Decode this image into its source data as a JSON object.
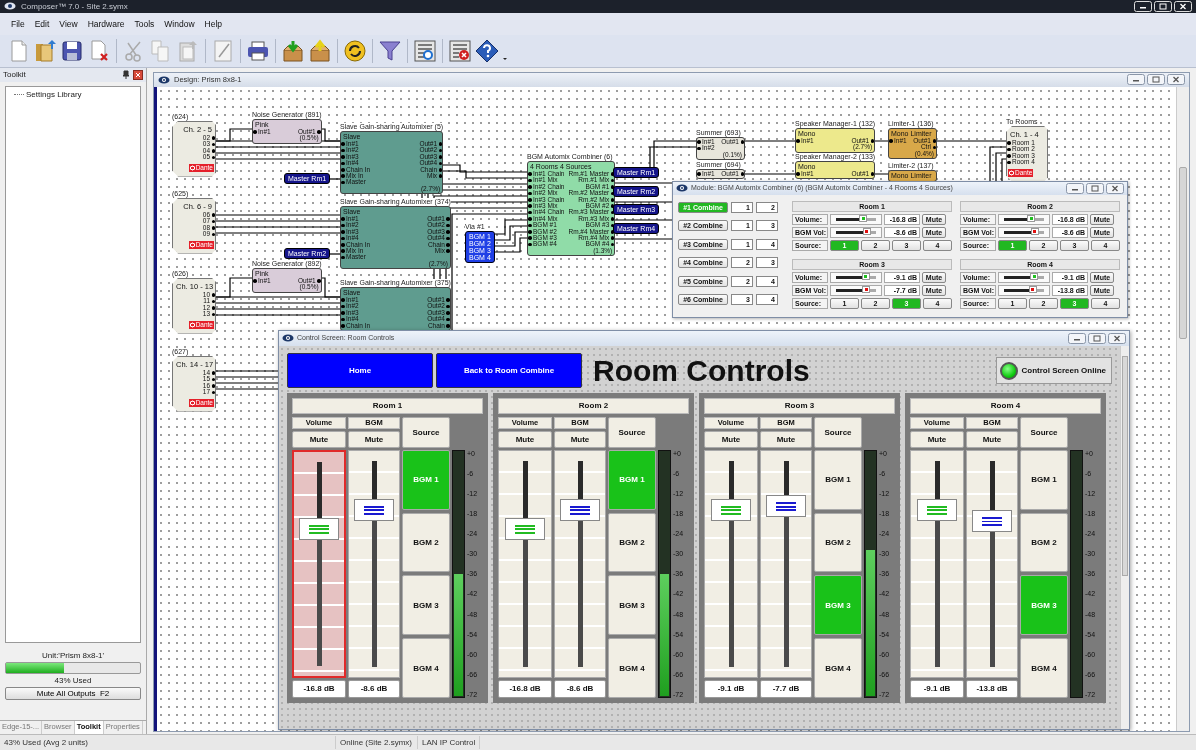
{
  "window": {
    "title": "Composer™ 7.0 - Site 2.symx"
  },
  "menu": [
    "File",
    "Edit",
    "View",
    "Hardware",
    "Tools",
    "Window",
    "Help"
  ],
  "toolkit": {
    "title": "Toolkit",
    "tree": [
      {
        "label": "Settings Library"
      }
    ],
    "unit": "Unit:'Prism 8x8-1'",
    "usage": {
      "level": 0.43,
      "text": "43% Used"
    },
    "mute_button": "Mute All Outputs  F2",
    "tabs": [
      {
        "label": "Edge-15-...",
        "selected": false
      },
      {
        "label": "Browser",
        "selected": false
      },
      {
        "label": "Toolkit",
        "selected": true
      },
      {
        "label": "Properties",
        "selected": false
      }
    ]
  },
  "design": {
    "title": "Design: Prism 8x8-1",
    "nodes": [
      {
        "kind": "device",
        "label": "(624)",
        "name": "Ch. 2 - 5",
        "ports": [
          "02",
          "03",
          "04",
          "05"
        ],
        "badge": "Dante"
      },
      {
        "kind": "device",
        "label": "(625)",
        "name": "Ch. 6 - 9",
        "ports": [
          "06",
          "07",
          "08",
          "09"
        ],
        "badge": "Dante"
      },
      {
        "kind": "device",
        "label": "(626)",
        "name": "Ch. 10 - 13",
        "ports": [
          "10",
          "11",
          "12",
          "13"
        ],
        "badge": "Dante"
      },
      {
        "kind": "device",
        "label": "(627)",
        "name": "Ch. 14 - 17",
        "ports": [
          "14",
          "15",
          "16",
          "17"
        ],
        "badge": "Dante"
      },
      {
        "kind": "block",
        "title": "Noise Generator (891)",
        "header": "Pink",
        "inputs": [
          "In#1"
        ],
        "outputs": [
          "Out#1"
        ],
        "footer": "(0.5%)",
        "color": "#d9ccd9"
      },
      {
        "kind": "block",
        "title": "Noise Generator (892)",
        "header": "Pink",
        "inputs": [
          "In#1"
        ],
        "outputs": [
          "Out#1"
        ],
        "footer": "(0.5%)",
        "color": "#d9ccd9"
      },
      {
        "kind": "block",
        "title": "Slave Gain-sharing Automixer (5)",
        "header": "Slave",
        "inputs": [
          "In#1",
          "In#2",
          "In#3",
          "In#4",
          "Chain In",
          "Mix In",
          "Master"
        ],
        "outputs": [
          "Out#1",
          "Out#2",
          "Out#3",
          "Out#4",
          "Chain",
          "Mix"
        ],
        "footer": "(2.7%)",
        "color": "#5f9c8f"
      },
      {
        "kind": "block",
        "title": "Slave Gain-sharing Automixer (374)",
        "header": "Slave",
        "inputs": [
          "In#1",
          "In#2",
          "In#3",
          "In#4",
          "Chain In",
          "Mix In",
          "Master"
        ],
        "outputs": [
          "Out#1",
          "Out#2",
          "Out#3",
          "Out#4",
          "Chain",
          "Mix"
        ],
        "footer": "(2.7%)",
        "color": "#5f9c8f"
      },
      {
        "kind": "block",
        "title": "Slave Gain-sharing Automixer (375)",
        "header": "Slave",
        "inputs": [
          "In#1",
          "In#2",
          "In#3",
          "In#4",
          "Chain In"
        ],
        "outputs": [
          "Out#1",
          "Out#2",
          "Out#3",
          "Out#4",
          "Chain"
        ],
        "color": "#5f9c8f"
      },
      {
        "kind": "tag",
        "text": "Master Rm1"
      },
      {
        "kind": "tag",
        "text": "Master Rm2"
      },
      {
        "kind": "via",
        "title": "Via #1",
        "ports": [
          "BGM 1",
          "BGM 2",
          "BGM 3",
          "BGM 4"
        ]
      },
      {
        "kind": "block",
        "title": "BGM Automix Combiner (6)",
        "header": "4 Rooms 4 Sources",
        "inputs": [
          "In#1 Chain",
          "In#1 Mix",
          "In#2 Chain",
          "In#2 Mix",
          "In#3 Chain",
          "In#3 Mix",
          "In#4 Chain",
          "In#4 Mix",
          "BGM #1",
          "BGM #2",
          "BGM #3",
          "BGM #4"
        ],
        "outputs": [
          "Rm.#1 Master",
          "Rm.#1 Mix",
          "BGM #1",
          "Rm.#2 Master",
          "Rm.#2 Mix",
          "BGM #2",
          "Rm.#3 Master",
          "Rm.#3 Mix",
          "BGM #3",
          "Rm.#4 Master",
          "Rm.#4 Mix",
          "BGM #4"
        ],
        "footer": "(1.3%)",
        "color": "#90dca8"
      },
      {
        "kind": "tag",
        "text": "Master Rm1"
      },
      {
        "kind": "tag",
        "text": "Master Rm2"
      },
      {
        "kind": "tag",
        "text": "Master Rm3"
      },
      {
        "kind": "tag",
        "text": "Master Rm4"
      },
      {
        "kind": "block",
        "title": "Summer (693)",
        "inputs": [
          "In#1",
          "In#2"
        ],
        "outputs": [
          "Out#1"
        ],
        "footer": "(0.1%)",
        "color": "#e8e6dc"
      },
      {
        "kind": "block",
        "title": "Summer (694)",
        "inputs": [
          "In#1"
        ],
        "outputs": [
          "Out#1"
        ],
        "color": "#e8e6dc"
      },
      {
        "kind": "block",
        "title": "Speaker Manager-1 (132)",
        "header": "Mono",
        "inputs": [
          "In#1"
        ],
        "outputs": [
          "Out#1"
        ],
        "footer": "(2.7%)",
        "color": "#ede98c"
      },
      {
        "kind": "block",
        "title": "Speaker Manager-2 (133)",
        "header": "Mono",
        "inputs": [
          "In#1"
        ],
        "outputs": [
          "Out#1"
        ],
        "color": "#ede98c"
      },
      {
        "kind": "block",
        "title": "Limiter-1 (136)",
        "header": "Mono Limiter",
        "inputs": [
          "In#1"
        ],
        "outputs": [
          "Out#1",
          "Ctrl"
        ],
        "footer": "(0.4%)",
        "color": "#d8a849"
      },
      {
        "kind": "block",
        "title": "Limiter-2 (137)",
        "header": "Mono Limiter",
        "color": "#d8a849"
      },
      {
        "kind": "output_device",
        "label": "To Rooms",
        "name": "Ch. 1 - 4",
        "ports": [
          "Room 1",
          "Room 2",
          "Room 3",
          "Room 4"
        ],
        "badge": "Dante"
      }
    ]
  },
  "module_window": {
    "title": "Module: BGM Automix Combiner (6) (BGM Automix Combiner - 4 Rooms 4 Sources)",
    "combines": [
      {
        "label": "#1 Combine",
        "on": true,
        "a": "1",
        "b": "2"
      },
      {
        "label": "#2 Combine",
        "on": false,
        "a": "1",
        "b": "3"
      },
      {
        "label": "#3 Combine",
        "on": false,
        "a": "1",
        "b": "4"
      },
      {
        "label": "#4 Combine",
        "on": false,
        "a": "2",
        "b": "3"
      },
      {
        "label": "#5 Combine",
        "on": false,
        "a": "2",
        "b": "4"
      },
      {
        "label": "#6 Combine",
        "on": false,
        "a": "3",
        "b": "4"
      }
    ],
    "rooms": [
      {
        "title": "Room 1",
        "volume": {
          "label": "Volume:",
          "level": 0.68,
          "value": "-16.8 dB",
          "mute": "Mute"
        },
        "bgm": {
          "label": "BGM Vol:",
          "level": 0.77,
          "value": "-8.6 dB",
          "mute": "Mute"
        },
        "source_label": "Source:",
        "sources": [
          {
            "label": "1",
            "selected": true
          },
          {
            "label": "2",
            "selected": false
          },
          {
            "label": "3",
            "selected": false
          },
          {
            "label": "4",
            "selected": false
          }
        ]
      },
      {
        "title": "Room 2",
        "volume": {
          "label": "Volume:",
          "level": 0.68,
          "value": "-16.8 dB",
          "mute": "Mute"
        },
        "bgm": {
          "label": "BGM Vol:",
          "level": 0.77,
          "value": "-8.6 dB",
          "mute": "Mute"
        },
        "source_label": "Source:",
        "sources": [
          {
            "label": "1",
            "selected": true
          },
          {
            "label": "2",
            "selected": false
          },
          {
            "label": "3",
            "selected": false
          },
          {
            "label": "4",
            "selected": false
          }
        ]
      },
      {
        "title": "Room 3",
        "volume": {
          "label": "Volume:",
          "level": 0.74,
          "value": "-9.1 dB",
          "mute": "Mute"
        },
        "bgm": {
          "label": "BGM Vol:",
          "level": 0.75,
          "value": "-7.7 dB",
          "mute": "Mute"
        },
        "source_label": "Source:",
        "sources": [
          {
            "label": "1",
            "selected": false
          },
          {
            "label": "2",
            "selected": false
          },
          {
            "label": "3",
            "selected": true
          },
          {
            "label": "4",
            "selected": false
          }
        ]
      },
      {
        "title": "Room 4",
        "volume": {
          "label": "Volume:",
          "level": 0.75,
          "value": "-9.1 dB",
          "mute": "Mute"
        },
        "bgm": {
          "label": "BGM Vol:",
          "level": 0.72,
          "value": "-13.8 dB",
          "mute": "Mute"
        },
        "source_label": "Source:",
        "sources": [
          {
            "label": "1",
            "selected": false
          },
          {
            "label": "2",
            "selected": false
          },
          {
            "label": "3",
            "selected": true
          },
          {
            "label": "4",
            "selected": false
          }
        ]
      }
    ]
  },
  "control_screen": {
    "title": "Control Screen: Room Controls",
    "buttons": [
      "Home",
      "Back to Room Combine"
    ],
    "heading": "Room Controls",
    "status": {
      "label": "Control Screen Online",
      "on": true
    },
    "rooms": [
      {
        "title": "Room 1",
        "volume_label": "Volume",
        "bgm_label": "BGM",
        "source_label": "Source",
        "volume_mute": "Mute",
        "bgm_mute": "Mute",
        "volume": {
          "level": 0.67,
          "selected": true,
          "value": "-16.8 dB"
        },
        "bgm": {
          "level": 0.76,
          "selected": false,
          "value": "-8.6 dB"
        },
        "sources": [
          {
            "label": "BGM 1",
            "selected": true
          },
          {
            "label": "BGM 2",
            "selected": false
          },
          {
            "label": "BGM 3",
            "selected": false
          },
          {
            "label": "BGM 4",
            "selected": false
          }
        ],
        "meter": {
          "level": 0.5
        },
        "scale": [
          "+0",
          "-6",
          "-12",
          "-18",
          "-24",
          "-30",
          "-36",
          "-42",
          "-48",
          "-54",
          "-60",
          "-66",
          "-72"
        ]
      },
      {
        "title": "Room 2",
        "volume_label": "Volume",
        "bgm_label": "BGM",
        "source_label": "Source",
        "volume_mute": "Mute",
        "bgm_mute": "Mute",
        "volume": {
          "level": 0.67,
          "selected": false,
          "value": "-16.8 dB"
        },
        "bgm": {
          "level": 0.76,
          "selected": false,
          "value": "-8.6 dB"
        },
        "sources": [
          {
            "label": "BGM 1",
            "selected": true
          },
          {
            "label": "BGM 2",
            "selected": false
          },
          {
            "label": "BGM 3",
            "selected": false
          },
          {
            "label": "BGM 4",
            "selected": false
          }
        ],
        "meter": {
          "level": 0.5
        },
        "scale": [
          "+0",
          "-6",
          "-12",
          "-18",
          "-24",
          "-30",
          "-36",
          "-42",
          "-48",
          "-54",
          "-60",
          "-66",
          "-72"
        ]
      },
      {
        "title": "Room 3",
        "volume_label": "Volume",
        "bgm_label": "BGM",
        "source_label": "Source",
        "volume_mute": "Mute",
        "bgm_mute": "Mute",
        "volume": {
          "level": 0.76,
          "selected": false,
          "value": "-9.1 dB"
        },
        "bgm": {
          "level": 0.78,
          "selected": false,
          "value": "-7.7 dB"
        },
        "sources": [
          {
            "label": "BGM 1",
            "selected": false
          },
          {
            "label": "BGM 2",
            "selected": false
          },
          {
            "label": "BGM 3",
            "selected": true
          },
          {
            "label": "BGM 4",
            "selected": false
          }
        ],
        "meter": {
          "level": 0.6
        },
        "scale": [
          "+0",
          "-6",
          "-12",
          "-18",
          "-24",
          "-30",
          "-36",
          "-42",
          "-48",
          "-54",
          "-60",
          "-66",
          "-72"
        ]
      },
      {
        "title": "Room 4",
        "volume_label": "Volume",
        "bgm_label": "BGM",
        "source_label": "Source",
        "volume_mute": "Mute",
        "bgm_mute": "Mute",
        "volume": {
          "level": 0.76,
          "selected": false,
          "value": "-9.1 dB"
        },
        "bgm": {
          "level": 0.71,
          "selected": false,
          "value": "-13.8 dB"
        },
        "sources": [
          {
            "label": "BGM 1",
            "selected": false
          },
          {
            "label": "BGM 2",
            "selected": false
          },
          {
            "label": "BGM 3",
            "selected": true
          },
          {
            "label": "BGM 4",
            "selected": false
          }
        ],
        "meter": {
          "level": 0
        },
        "scale": [
          "+0",
          "-6",
          "-12",
          "-18",
          "-24",
          "-30",
          "-36",
          "-42",
          "-48",
          "-54",
          "-60",
          "-66",
          "-72"
        ]
      }
    ]
  },
  "status_bar": [
    "43% Used (Avg 2 units)",
    "Online (Site 2.symx)",
    "LAN IP Control"
  ]
}
